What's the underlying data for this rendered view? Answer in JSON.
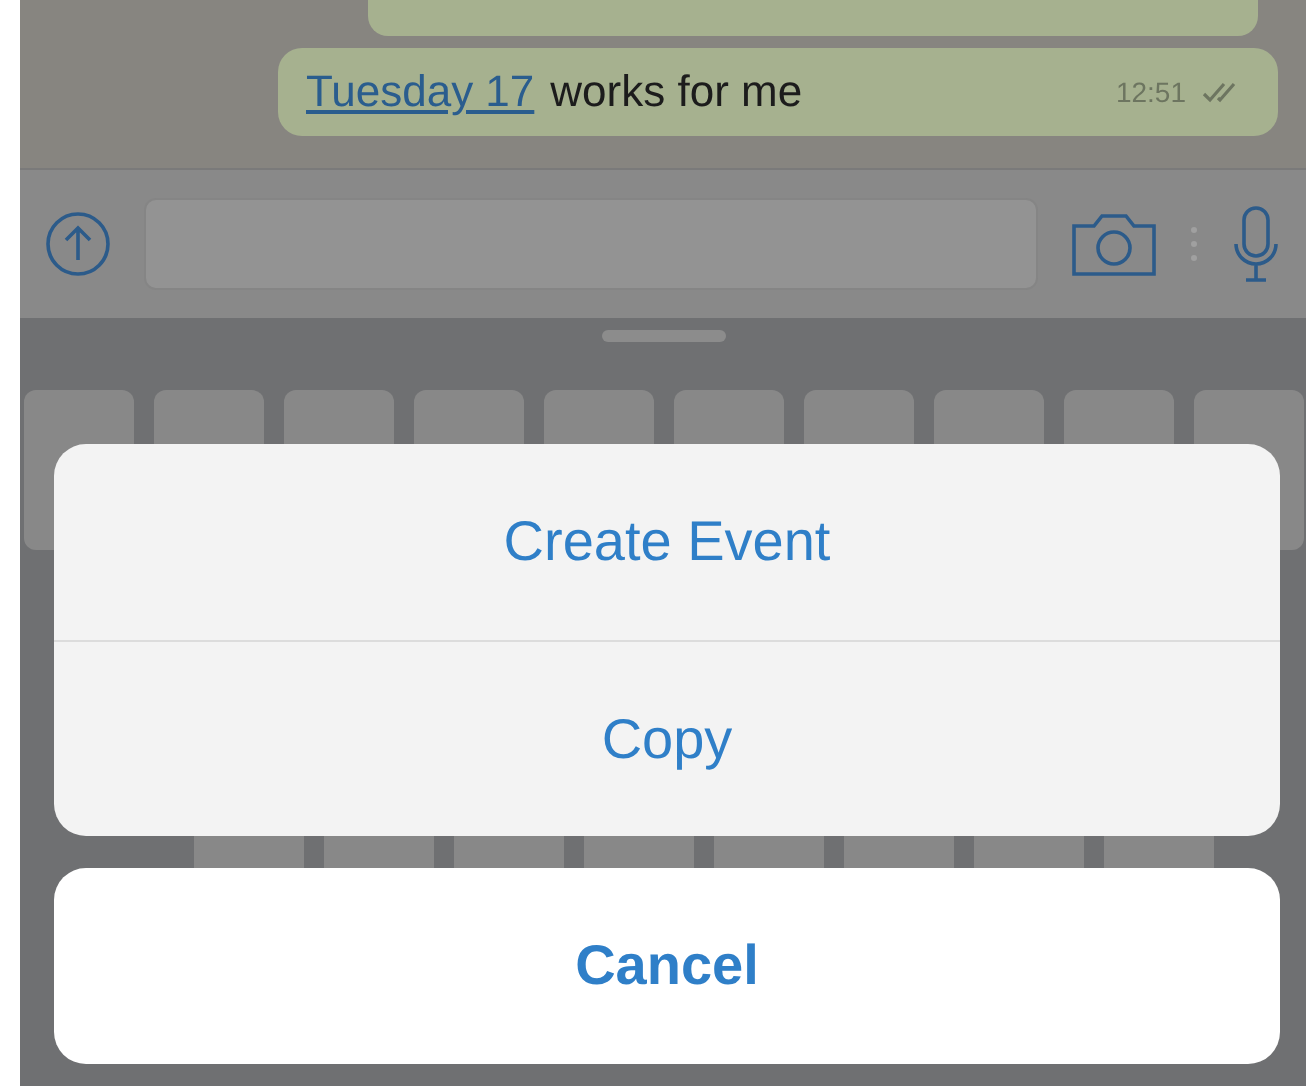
{
  "message": {
    "link": "Tuesday 17",
    "text": "works for me",
    "time": "12:51"
  },
  "action_sheet": {
    "actions": [
      "Create Event",
      "Copy"
    ],
    "cancel": "Cancel"
  }
}
